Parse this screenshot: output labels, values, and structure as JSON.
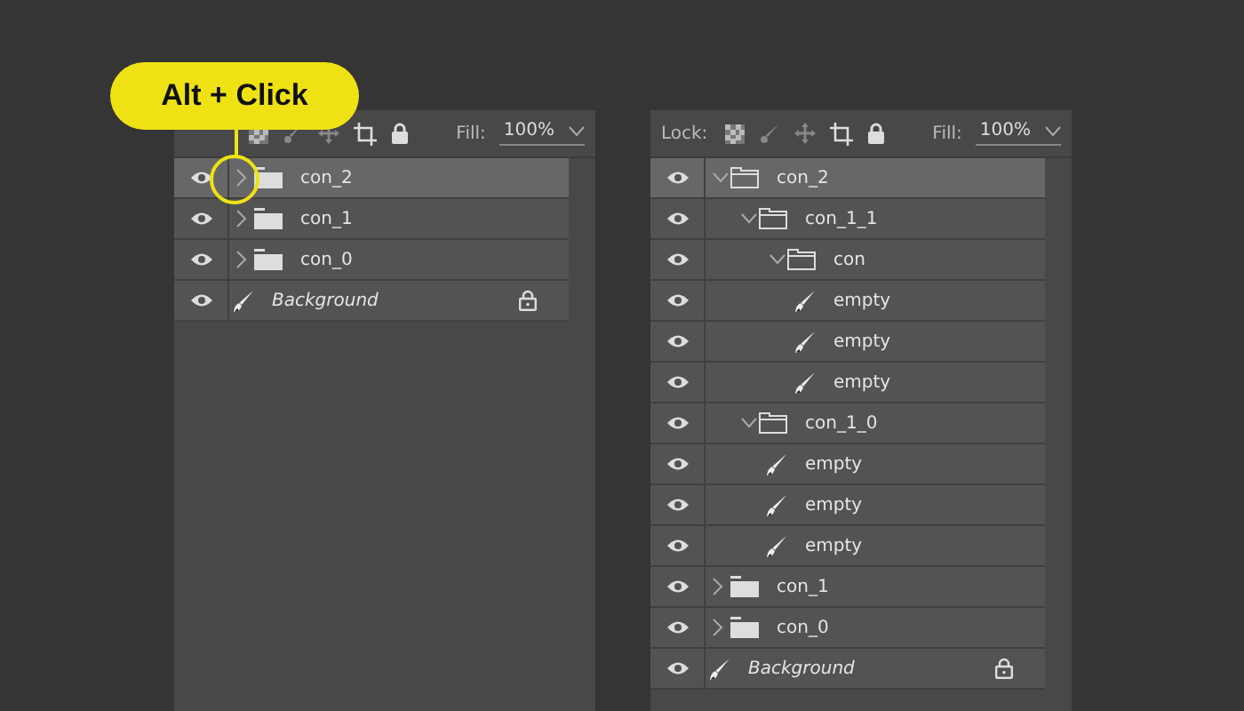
{
  "callout": {
    "text": "Alt + Click"
  },
  "panels": [
    {
      "toolbar": {
        "fill_label": "Fill:",
        "fill_value": "100%"
      },
      "layers": [
        {
          "name": "con_2",
          "kind": "group",
          "visible": true,
          "expanded": false,
          "selected": true,
          "locked": false
        },
        {
          "name": "con_1",
          "kind": "group",
          "visible": true,
          "expanded": false,
          "selected": false,
          "locked": false
        },
        {
          "name": "con_0",
          "kind": "group",
          "visible": true,
          "expanded": false,
          "selected": false,
          "locked": false
        },
        {
          "name": "Background",
          "kind": "background",
          "visible": true,
          "selected": false,
          "locked": true
        }
      ]
    },
    {
      "toolbar": {
        "lock_label": "Lock:",
        "fill_label": "Fill:",
        "fill_value": "100%"
      },
      "layers": [
        {
          "name": "con_2",
          "kind": "group",
          "visible": true,
          "expanded": true,
          "selected": true,
          "locked": false,
          "children": [
            {
              "name": "con_1_1",
              "kind": "group",
              "visible": true,
              "expanded": true,
              "selected": false,
              "locked": false,
              "children": [
                {
                  "name": "con",
                  "kind": "group",
                  "visible": true,
                  "expanded": true,
                  "selected": false,
                  "locked": false,
                  "children": [
                    {
                      "name": "empty",
                      "kind": "layer",
                      "visible": true,
                      "selected": false,
                      "locked": false
                    },
                    {
                      "name": "empty",
                      "kind": "layer",
                      "visible": true,
                      "selected": false,
                      "locked": false
                    },
                    {
                      "name": "empty",
                      "kind": "layer",
                      "visible": true,
                      "selected": false,
                      "locked": false
                    }
                  ]
                }
              ]
            },
            {
              "name": "con_1_0",
              "kind": "group",
              "visible": true,
              "expanded": true,
              "selected": false,
              "locked": false,
              "children": [
                {
                  "name": "empty",
                  "kind": "layer",
                  "visible": true,
                  "selected": false,
                  "locked": false
                },
                {
                  "name": "empty",
                  "kind": "layer",
                  "visible": true,
                  "selected": false,
                  "locked": false
                },
                {
                  "name": "empty",
                  "kind": "layer",
                  "visible": true,
                  "selected": false,
                  "locked": false
                }
              ]
            }
          ]
        },
        {
          "name": "con_1",
          "kind": "group",
          "visible": true,
          "expanded": false,
          "selected": false,
          "locked": false
        },
        {
          "name": "con_0",
          "kind": "group",
          "visible": true,
          "expanded": false,
          "selected": false,
          "locked": false
        },
        {
          "name": "Background",
          "kind": "background",
          "visible": true,
          "selected": false,
          "locked": true
        }
      ]
    }
  ]
}
